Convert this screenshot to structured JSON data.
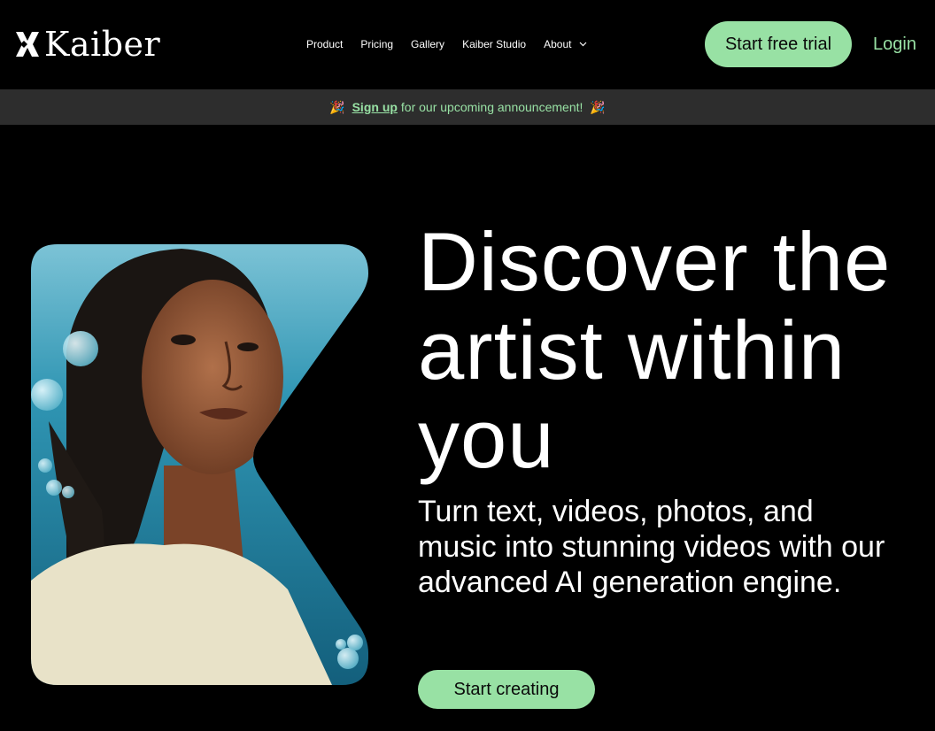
{
  "header": {
    "brand": "Kaiber",
    "nav": [
      {
        "label": "Product"
      },
      {
        "label": "Pricing"
      },
      {
        "label": "Gallery"
      },
      {
        "label": "Kaiber Studio"
      },
      {
        "label": "About"
      }
    ],
    "trial_label": "Start free trial",
    "login_label": "Login"
  },
  "announcement": {
    "emoji_left": "🎉",
    "signup_link": "Sign up",
    "text": "for our upcoming announcement!",
    "emoji_right": "🎉"
  },
  "hero": {
    "headline": "Discover the artist within you",
    "subline": "Turn text, videos, photos, and music into stunning videos with our advanced AI generation engine.",
    "cta_label": "Start creating"
  },
  "colors": {
    "accent": "#98e1a4",
    "background": "#000000",
    "banner": "#2d2d2d"
  }
}
